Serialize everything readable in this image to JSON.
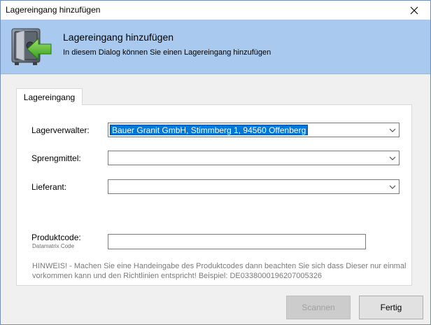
{
  "window": {
    "title": "Lagereingang hinzufügen"
  },
  "header": {
    "title": "Lagereingang hinzufügen",
    "subtitle": "In diesem Dialog können Sie einen Lagereingang hinzufügen",
    "icon": "safe-with-arrow-icon",
    "background": "#a9c9ee"
  },
  "tabs": [
    {
      "label": "Lagereingang",
      "active": true
    }
  ],
  "form": {
    "lagerverwalter": {
      "label": "Lagerverwalter:",
      "value": "Bauer Granit GmbH, Stimmberg 1, 94560 Offenberg"
    },
    "sprengmittel": {
      "label": "Sprengmittel:",
      "value": ""
    },
    "lieferant": {
      "label": "Lieferant:",
      "value": ""
    },
    "produktcode": {
      "label": "Produktcode:",
      "sublabel": "Datamatrix Code",
      "value": ""
    },
    "hint": "HINWEIS! - Machen Sie eine Handeingabe des Produktcodes dann beachten Sie sich dass Dieser nur einmal vorkommen kann und den Richtlinien entspricht! Beispiel: DE0338000196207005326"
  },
  "buttons": {
    "scannen": {
      "label": "Scannen",
      "enabled": false
    },
    "fertig": {
      "label": "Fertig",
      "enabled": true
    }
  },
  "colors": {
    "selection": "#0078d7",
    "accent_border": "#6f8fb8"
  }
}
